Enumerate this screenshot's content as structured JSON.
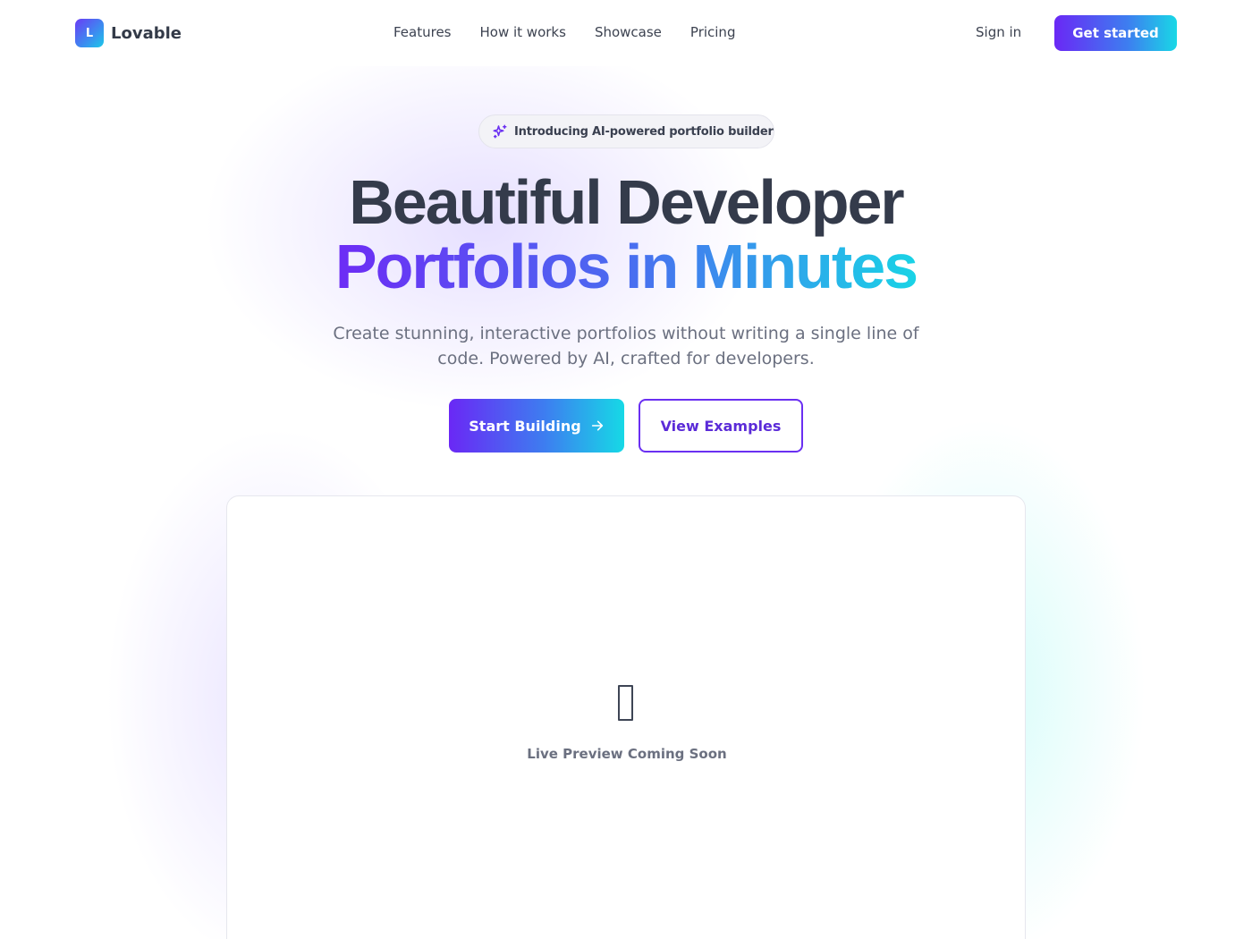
{
  "brand": {
    "logo_letter": "L",
    "name": "Lovable"
  },
  "nav": {
    "links": [
      "Features",
      "How it works",
      "Showcase",
      "Pricing"
    ],
    "sign_in": "Sign in",
    "cta": "Get started"
  },
  "hero": {
    "badge": "Introducing AI-powered portfolio builder",
    "badge_icon": "sparkles-icon",
    "title_line1": "Beautiful Developer",
    "title_line2": "Portfolios in Minutes",
    "subtitle": "Create stunning, interactive portfolios without writing a single line of code. Powered by AI, crafted for developers.",
    "primary_button": "Start Building",
    "primary_button_icon": "arrow-right-icon",
    "secondary_button": "View Examples"
  },
  "preview": {
    "message": "Live Preview Coming Soon",
    "icon": "placeholder-glyph-icon"
  },
  "colors": {
    "accent_purple": "#6a28f5",
    "accent_cyan": "#19d8e6",
    "heading": "#343b4b",
    "muted": "#6b7080"
  }
}
